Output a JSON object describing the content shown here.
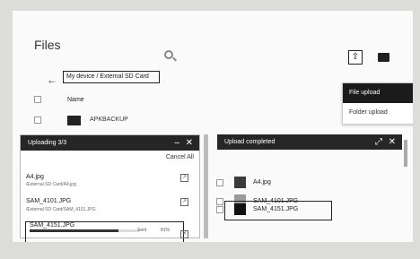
{
  "title": "Files",
  "breadcrumb": "My device / External SD Card",
  "toolbar": {
    "upload_icon": "upload-icon",
    "folder_icon": "folder-icon",
    "zoom_icon": "zoom-icon"
  },
  "menu": {
    "items": [
      {
        "label": "File upload"
      },
      {
        "label": "Folder upload"
      }
    ]
  },
  "list": {
    "column_name": "Name",
    "folder_name": "APKBACKUP"
  },
  "uploading_panel": {
    "title": "Uploading 3/3",
    "cancel_all": "Cancel All",
    "files": [
      {
        "name": "A4.jpg",
        "path": "/External SD Card/A4.jpg"
      },
      {
        "name": "SAM_4101.JPG",
        "path": "/External SD Card/SAM_4101.JPG"
      },
      {
        "name": "SAM_4151.JPG",
        "progress_label": "Sent",
        "progress": 0.81,
        "progress_text": "81%"
      }
    ]
  },
  "completed_panel": {
    "title": "Upload completed",
    "files": [
      {
        "name": "A4.jpg"
      },
      {
        "name": "SAM_4101.JPG"
      },
      {
        "name": "SAM_4151.JPG"
      }
    ]
  },
  "colors": {
    "header_dark": "#262626",
    "menu_active": "#1b1b1b"
  }
}
